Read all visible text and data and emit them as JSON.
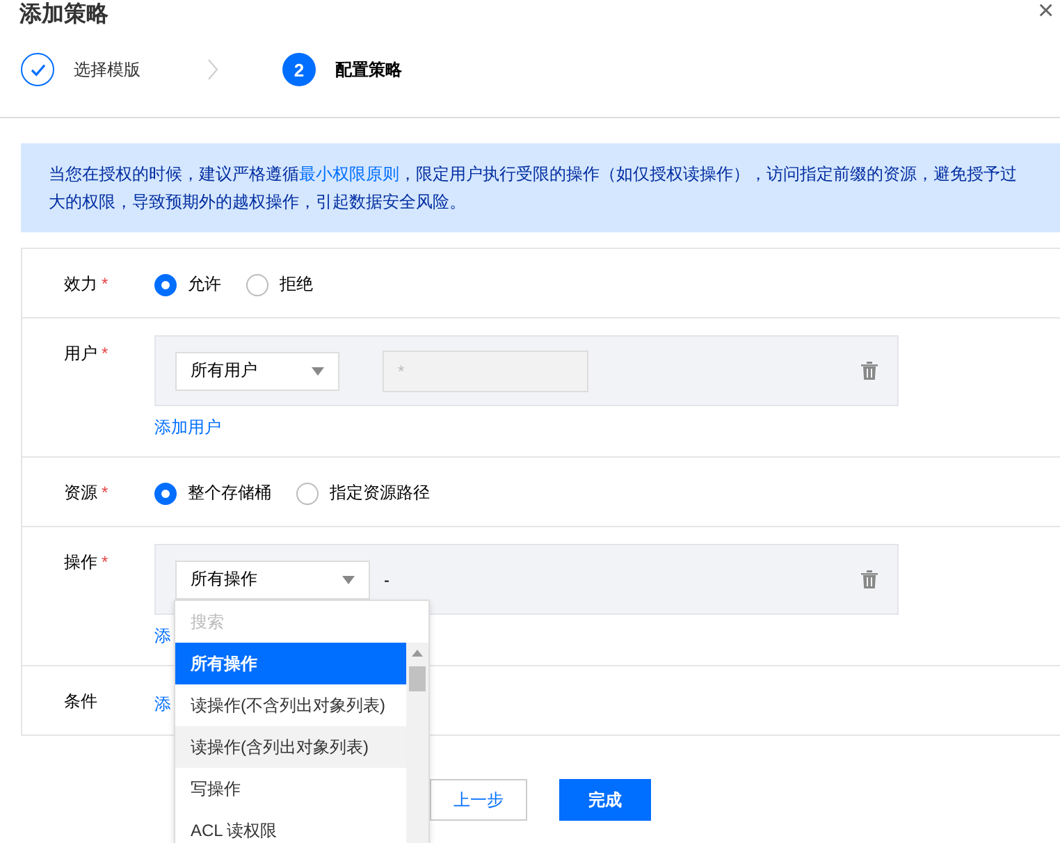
{
  "dialog": {
    "title": "添加策略",
    "close": "×"
  },
  "steps": [
    {
      "label": "选择模版",
      "done": true,
      "selected": false
    },
    {
      "label": "配置策略",
      "number": "2",
      "done": false,
      "selected": true
    }
  ],
  "alert": {
    "link": "最小权限原则",
    "before": "当您在授权的时候，建议严格遵循",
    "after": "，限定用户执行受限的操作（如仅授权读操作），访问指定前缀的资源，避免授予过大的权限，导致预期外的越权操作，引起数据安全风险。"
  },
  "form": [
    {
      "kind": "radio",
      "label": "效力",
      "required": true,
      "options": [
        {
          "label": "允许",
          "selected": true
        },
        {
          "label": "拒绝",
          "selected": false
        }
      ]
    },
    {
      "kind": "user",
      "label": "用户",
      "required": true,
      "select": "所有用户",
      "input_placeholder": "*",
      "add_link": "添加用户"
    },
    {
      "kind": "radio",
      "label": "资源",
      "required": true,
      "options": [
        {
          "label": "整个存储桶",
          "selected": true
        },
        {
          "label": "指定资源路径",
          "selected": false
        }
      ]
    },
    {
      "kind": "action",
      "label": "操作",
      "required": true,
      "select": "所有操作",
      "value": "-",
      "add_link": "添"
    },
    {
      "kind": "link",
      "label": "条件",
      "required": false,
      "add_link": "添"
    }
  ],
  "dropdown": {
    "placeholder": "搜索",
    "items": [
      {
        "label": "所有操作",
        "selected": true,
        "hovered": false
      },
      {
        "label": "读操作(不含列出对象列表)",
        "selected": false,
        "hovered": false
      },
      {
        "label": "读操作(含列出对象列表)",
        "selected": false,
        "hovered": true
      },
      {
        "label": "写操作",
        "selected": false,
        "hovered": false
      },
      {
        "label": "ACL 读权限",
        "selected": false,
        "hovered": false
      }
    ]
  },
  "buttons": [
    {
      "label": "上一步",
      "kind": "secondary"
    },
    {
      "label": "完成",
      "kind": "primary"
    }
  ]
}
